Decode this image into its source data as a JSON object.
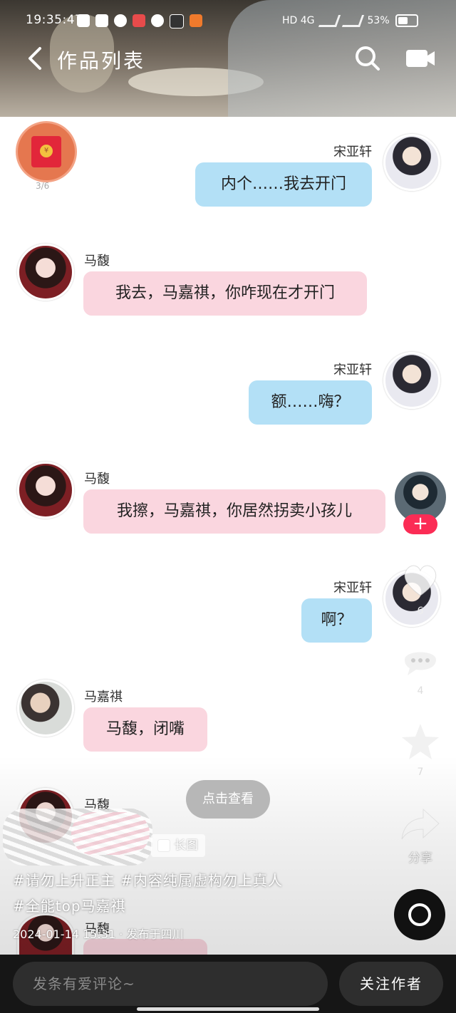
{
  "status_bar": {
    "time": "19:35:47",
    "network": "HD 4G",
    "battery": "53%"
  },
  "header": {
    "title": "作品列表"
  },
  "red_packet": {
    "count": "3/6"
  },
  "messages": [
    {
      "side": "right",
      "sender": "宋亚轩",
      "text": "内个……我去开门",
      "color": "blue"
    },
    {
      "side": "left",
      "sender": "马馥",
      "text": "我去，马嘉祺，你咋现在才开门",
      "color": "pink"
    },
    {
      "side": "right",
      "sender": "宋亚轩",
      "text": "额……嗨？",
      "color": "blue"
    },
    {
      "side": "left",
      "sender": "马馥",
      "text": "我擦，马嘉祺，你居然拐卖小孩儿",
      "color": "pink"
    },
    {
      "side": "right",
      "sender": "宋亚轩",
      "text": "啊？",
      "color": "blue"
    },
    {
      "side": "left",
      "sender": "马嘉祺",
      "text": "马馥，闭嘴",
      "color": "pink"
    },
    {
      "side": "left",
      "sender": "马馥",
      "text": "",
      "color": "pink"
    },
    {
      "side": "left",
      "sender": "马馥",
      "text": "",
      "color": "pink"
    }
  ],
  "rail": {
    "follow_plus": "+",
    "like_count": "6",
    "comment_count": "4",
    "favorite_count": "7",
    "share_label": "分享"
  },
  "overlay": {
    "tap_view": "点击查看",
    "long_image_tag": "长图",
    "hashtags_line1": "#请勿上升正主 #内容纯属虚构勿上真人",
    "hashtags_line2": "#全能top马嘉祺",
    "publish_info": "2024-01-14 15:31 · 发布于四川"
  },
  "bottom_bar": {
    "comment_placeholder": "发条有爱评论~",
    "follow_author": "关注作者"
  },
  "colors": {
    "bubble_blue": "#b3e0f6",
    "bubble_pink": "#fad6df",
    "accent_red": "#fb2c55"
  }
}
